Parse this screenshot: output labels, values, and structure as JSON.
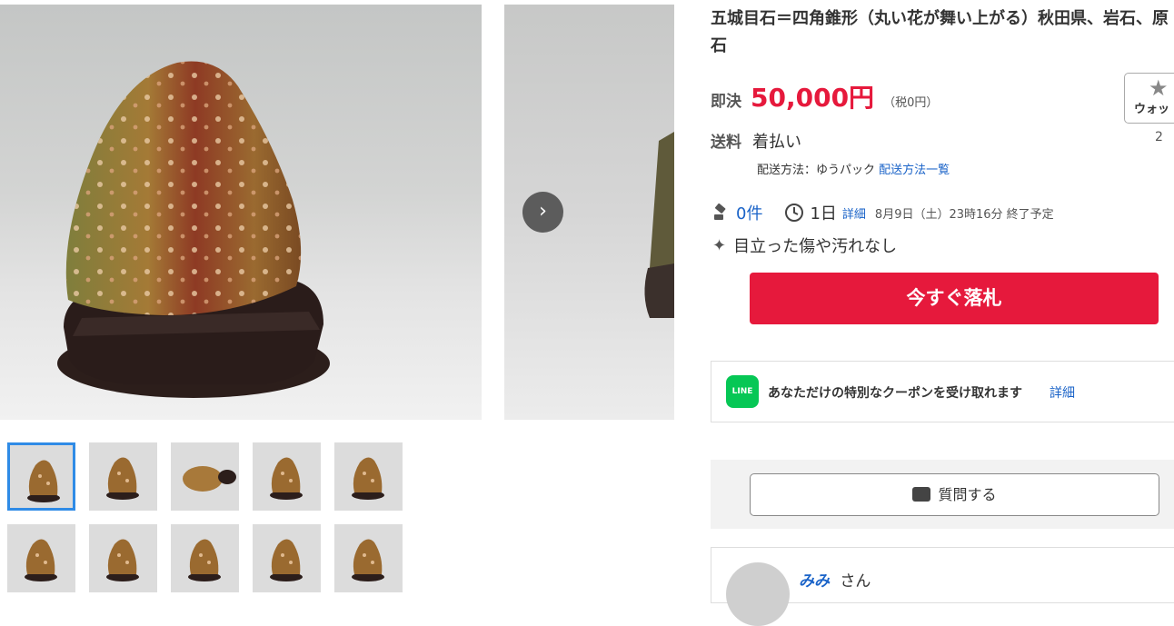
{
  "item": {
    "title": "五城目石＝四角錐形（丸い花が舞い上がる）秋田県、岩石、原石"
  },
  "price": {
    "label": "即決",
    "amount": "50,000円",
    "tax": "（税0円）"
  },
  "watch": {
    "label": "ウォッ",
    "count": "2"
  },
  "shipping": {
    "label": "送料",
    "value": "着払い",
    "method": "配送方法：ゆうパック",
    "method_link": "配送方法一覧"
  },
  "stats": {
    "bids": "0件",
    "time_left": "1日",
    "detail_link": "詳細",
    "end_time": "8月9日（土）23時16分 終了予定"
  },
  "condition": "目立った傷や汚れなし",
  "buy_now_button": "今すぐ落札",
  "coupon": {
    "badge": "LINE",
    "text": "あなただけの特別なクーポンを受け取れます",
    "link": "詳細"
  },
  "question_button": "質問する",
  "seller": {
    "name": "みみ",
    "suffix": "さん"
  },
  "gallery": {
    "next_arrow": "›"
  },
  "icons": {
    "bid": "gavel-icon",
    "time": "clock-icon",
    "condition": "sparkle-icon",
    "watch": "star-icon",
    "question": "speech-bubble-icon"
  },
  "colors": {
    "accent_red": "#e6193c",
    "link_blue": "#1a63c8",
    "line_green": "#06c755",
    "thumb_active": "#2f8be6"
  }
}
